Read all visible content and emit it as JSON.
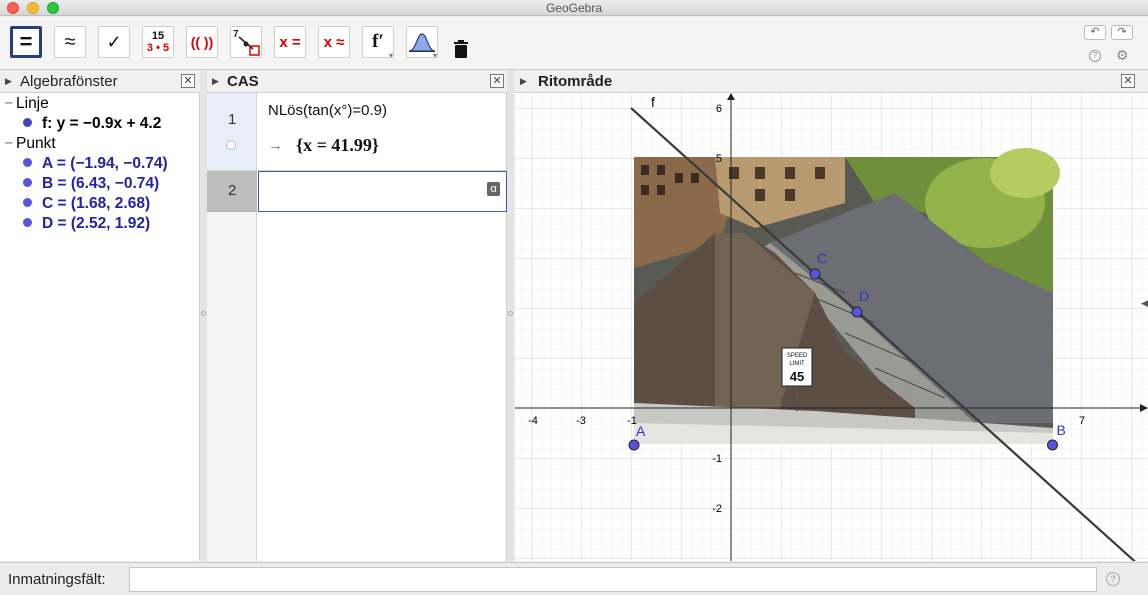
{
  "window": {
    "title": "GeoGebra"
  },
  "toolbar": {
    "tools": [
      {
        "name": "evaluate",
        "label": "="
      },
      {
        "name": "numeric",
        "label": "≈"
      },
      {
        "name": "keep-input",
        "label": "✓"
      },
      {
        "name": "factor",
        "top": "15",
        "bottom": "3 • 5"
      },
      {
        "name": "expand",
        "label": "(( ))"
      },
      {
        "name": "substitute",
        "label": "7"
      },
      {
        "name": "solve",
        "label": "x ="
      },
      {
        "name": "solve-numerically",
        "label": "x ≈"
      },
      {
        "name": "derivative",
        "label": "f′"
      },
      {
        "name": "probability",
        "label": ""
      },
      {
        "name": "delete",
        "label": ""
      }
    ]
  },
  "algebra": {
    "title": "Algebrafönster",
    "groups": [
      {
        "label": "Linje",
        "items": [
          {
            "text": "f: y = −0.9x + 4.2",
            "color": "#000000"
          }
        ]
      },
      {
        "label": "Punkt",
        "items": [
          {
            "text": "A = (−1.94, −0.74)",
            "color": "#2222aa"
          },
          {
            "text": "B = (6.43, −0.74)",
            "color": "#2222aa"
          },
          {
            "text": "C = (1.68, 2.68)",
            "color": "#2222aa"
          },
          {
            "text": "D = (2.52, 1.92)",
            "color": "#2222aa"
          }
        ]
      }
    ]
  },
  "cas": {
    "title": "CAS",
    "rows": [
      {
        "number": "1",
        "input": "NLös(tan(x°)=0.9)",
        "output": "{x = 41.99}",
        "arrow": "→"
      },
      {
        "number": "2",
        "input": "",
        "output": ""
      }
    ],
    "alpha_label": "α"
  },
  "graphics": {
    "title": "Ritområde",
    "x_ticks": [
      "-4",
      "-3",
      "-1",
      "7"
    ],
    "y_ticks": [
      "6",
      "5",
      "-1",
      "-2"
    ],
    "line_label": "f",
    "points": [
      {
        "label": "A",
        "x": -1.94,
        "y": -0.74
      },
      {
        "label": "B",
        "x": 6.43,
        "y": -0.74
      },
      {
        "label": "C",
        "x": 1.68,
        "y": 2.68
      },
      {
        "label": "D",
        "x": 2.52,
        "y": 1.92
      }
    ],
    "sign": {
      "line1": "SPEED",
      "line2": "LIMIT",
      "number": "45"
    }
  },
  "input_bar": {
    "label": "Inmatningsfält:",
    "value": ""
  },
  "colors": {
    "accent": "#2a3d7c",
    "point": "#5555dd",
    "solve_red": "#dd0000"
  }
}
